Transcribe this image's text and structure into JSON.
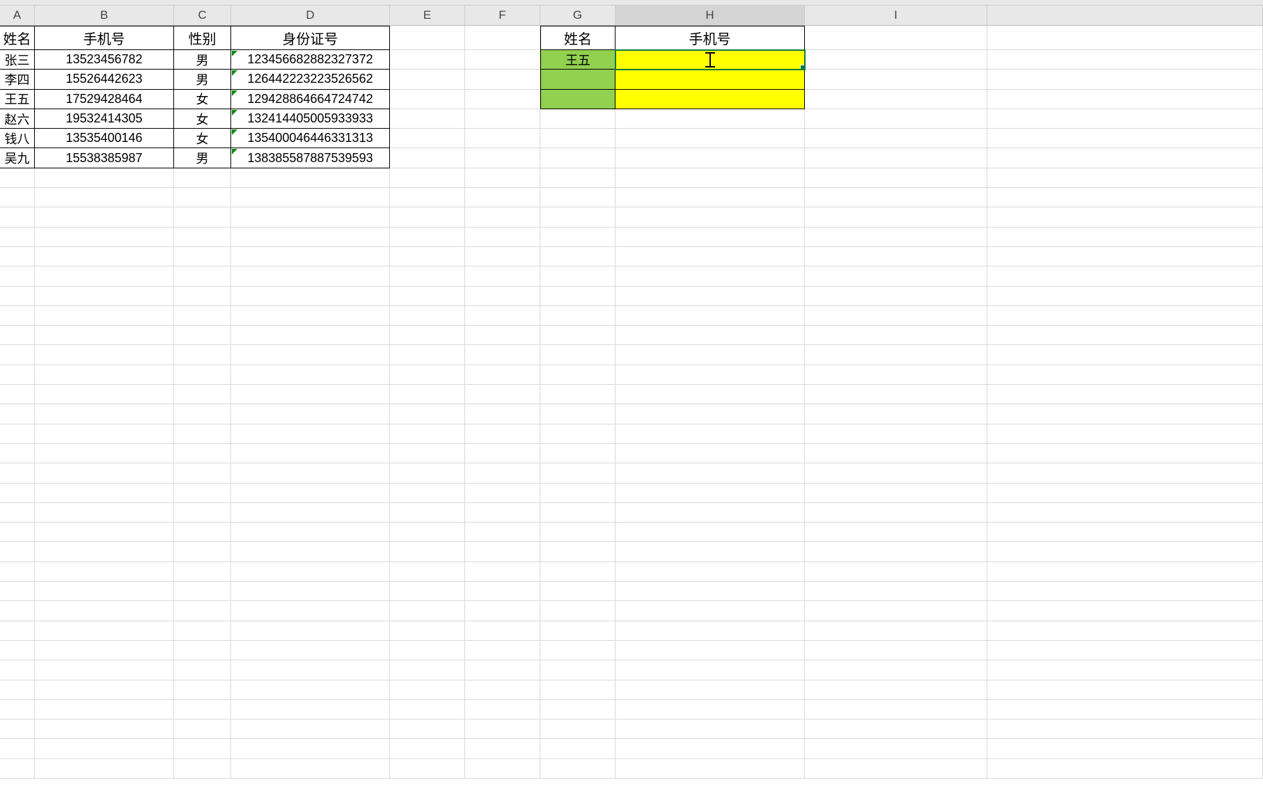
{
  "columns": [
    "A",
    "B",
    "C",
    "D",
    "E",
    "F",
    "G",
    "H",
    "I"
  ],
  "activeColumn": "H",
  "table1": {
    "headers": {
      "A": "姓名",
      "B": "手机号",
      "C": "性别",
      "D": "身份证号"
    },
    "rows": [
      {
        "A": "张三",
        "B": "13523456782",
        "C": "男",
        "D": "123456682882327372"
      },
      {
        "A": "李四",
        "B": "15526442623",
        "C": "男",
        "D": "126442223223526562"
      },
      {
        "A": "王五",
        "B": "17529428464",
        "C": "女",
        "D": "129428864664724742"
      },
      {
        "A": "赵六",
        "B": "19532414305",
        "C": "女",
        "D": "132414405005933933"
      },
      {
        "A": "钱八",
        "B": "13535400146",
        "C": "女",
        "D": "135400046446331313"
      },
      {
        "A": "吴九",
        "B": "15538385987",
        "C": "男",
        "D": "138385587887539593"
      }
    ]
  },
  "table2": {
    "headers": {
      "G": "姓名",
      "H": "手机号"
    },
    "rows": [
      {
        "G": "王五",
        "H": ""
      },
      {
        "G": "",
        "H": ""
      },
      {
        "G": "",
        "H": ""
      }
    ]
  }
}
